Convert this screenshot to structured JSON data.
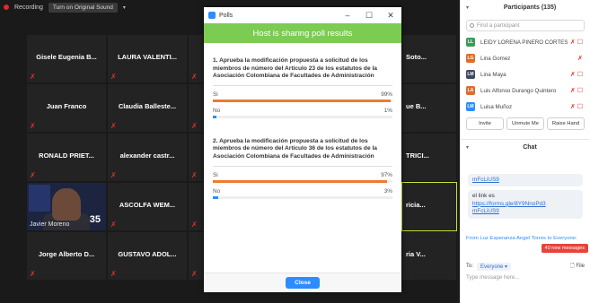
{
  "topbar": {
    "recording": "Recording",
    "original_sound": "Turn on Original Sound"
  },
  "gallery": {
    "tiles": [
      {
        "name": "Gisele Eugenia B..."
      },
      {
        "name": "LAURA VALENTI..."
      },
      {
        "name": "Soto..."
      },
      {
        "name": "Juan Franco"
      },
      {
        "name": "Claudia Balleste..."
      },
      {
        "name": "ue B..."
      },
      {
        "name": "RONALD PRIET..."
      },
      {
        "name": "alexander castr..."
      },
      {
        "name": "TRICI..."
      },
      {
        "name": "ASCOLFA WEM..."
      },
      {
        "name": "ricia..."
      },
      {
        "name": "Jorge Alberto D..."
      },
      {
        "name": "GUSTAVO ADOL..."
      },
      {
        "name": "ria V..."
      }
    ],
    "video_tile": {
      "name": "Javier Moreno",
      "overlay_number": "35"
    }
  },
  "poll": {
    "window_title": "Polls",
    "banner": "Host is sharing poll results",
    "questions": [
      {
        "text": "1. Aprueba la modificación propuesta a solicitud de los miembros de número del Articulo 23 de los estatutos de la Asociación Colombiana de Facultades de Administración",
        "options": [
          {
            "label": "Si",
            "percent_text": "99%",
            "percent": 99
          },
          {
            "label": "No",
            "percent_text": "1%",
            "percent": 1
          }
        ]
      },
      {
        "text": "2. Aprueba la modificación propuesta a solicitud de los miembros de número del Articulo 36 de los estatutos de la Asociación Colombiana de Facultades de Administración",
        "options": [
          {
            "label": "Si",
            "percent_text": "97%",
            "percent": 97
          },
          {
            "label": "No",
            "percent_text": "3%",
            "percent": 3
          }
        ]
      }
    ],
    "close_label": "Close"
  },
  "participants": {
    "title": "Participants (135)",
    "search_placeholder": "Find a participant",
    "list": [
      {
        "initials": "LL",
        "name": "LEIDY LORENA PIÑERO CORTES",
        "color": "#3a9b5a"
      },
      {
        "initials": "LG",
        "name": "Lina Gomez",
        "color": "#e06b2a"
      },
      {
        "initials": "LM",
        "name": "Lina Maya",
        "color": "#3d4a63"
      },
      {
        "initials": "LA",
        "name": "Luis Alfonso Durango Quintero",
        "color": "#e06b2a"
      },
      {
        "initials": "LM",
        "name": "Luisa Muñoz",
        "color": "#2d8cff"
      }
    ],
    "actions": {
      "invite": "Invite",
      "unmute": "Unmute Me",
      "raise_hand": "Raise Hand"
    }
  },
  "chat": {
    "title": "Chat",
    "partial_link": "mFcLiUS9",
    "message_label": "el link es",
    "message_link_1": "https://forms.gle/8Y9NnoPd3",
    "message_link_2": "mFcLiUS9",
    "from_line": "From Luz Esperanza Angel Torres to Everyone:",
    "new_messages": "40 new messages",
    "to_label": "To:",
    "to_value": "Everyone",
    "file_label": "File",
    "type_placeholder": "Type message here..."
  }
}
